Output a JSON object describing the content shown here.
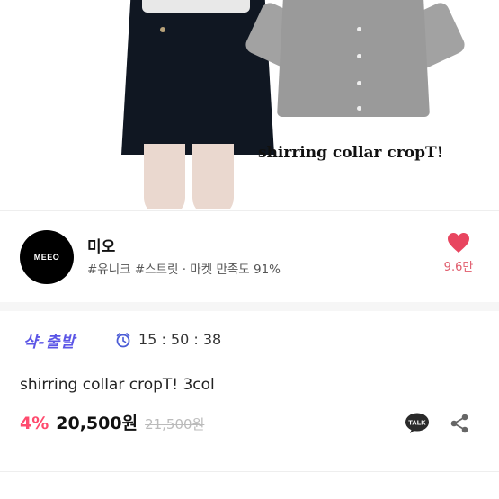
{
  "hero": {
    "caption": "shirring collar cropT!"
  },
  "shop": {
    "avatar_text": "MEEO",
    "name": "미오",
    "tags": "#유니크 #스트릿 · 마켓 만족도 91%",
    "likes": "9.6만"
  },
  "deal": {
    "ship_badge": "샥-출발",
    "timer": "15 : 50 : 38",
    "title": "shirring collar cropT! 3col",
    "discount": "4%",
    "price": "20,500원",
    "original_price": "21,500원"
  },
  "icons": {
    "like": "heart-icon",
    "timer": "alarm-clock-icon",
    "chat": "kakao-talk-icon",
    "share": "share-icon"
  },
  "colors": {
    "heart": "#e8455f",
    "ship_badge": "#5b55e6",
    "discount": "#ff4b6e",
    "timer_icon": "#4a5bd6",
    "talk_bg": "#2a2a2a"
  }
}
